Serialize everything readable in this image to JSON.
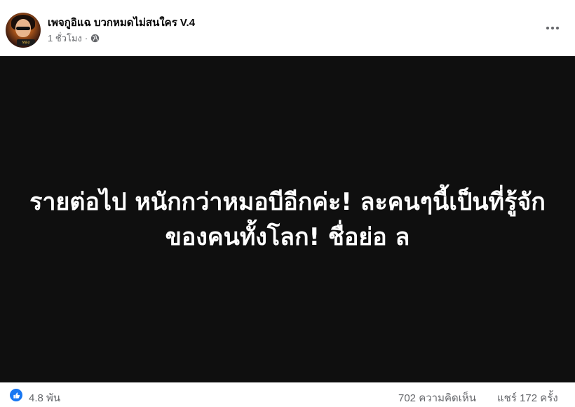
{
  "post": {
    "author": "เพจกูอิแฉ บวกหมดไม่สนใคร V.4",
    "time": "1 ชั่วโมง",
    "separator": "·",
    "audience_icon": "globe-icon",
    "avatar_badge": "ทอง",
    "media_text": "รายต่อไป หนักกว่าหมอบีอีกค่ะ! ละคนๆนี้เป็นที่รู้จักของคนทั้งโลก! ชื่อย่อ ล"
  },
  "footer": {
    "reaction_icon": "like-icon",
    "reactions": "4.8 พัน",
    "comments": "702 ความคิดเห็น",
    "shares": "แชร์ 172 ครั้ง"
  },
  "colors": {
    "accent": "#1877f2",
    "media_bg": "#0f0f0f",
    "secondary_text": "#65676b"
  }
}
